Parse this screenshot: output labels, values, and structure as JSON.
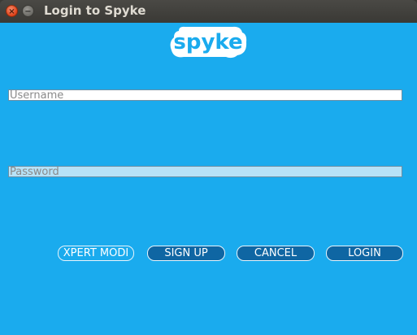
{
  "window": {
    "title": "Login to Spyke",
    "close_glyph": "×",
    "minimize_glyph": "−"
  },
  "logo": {
    "text": "spyke",
    "icon": "spyke-cloud-logo",
    "colors": {
      "cloud": "#ffffff",
      "text": "#1aabee"
    }
  },
  "form": {
    "username": {
      "placeholder": "Username",
      "value": ""
    },
    "password": {
      "placeholder": "Password",
      "value": ""
    }
  },
  "buttons": {
    "expert_mode": "XPERT MODI",
    "sign_up": "SIGN UP",
    "cancel": "CANCEL",
    "login": "LOGIN"
  },
  "colors": {
    "background": "#1aabee",
    "button": "#0f66a3",
    "titlebar": "#3c3b37"
  }
}
